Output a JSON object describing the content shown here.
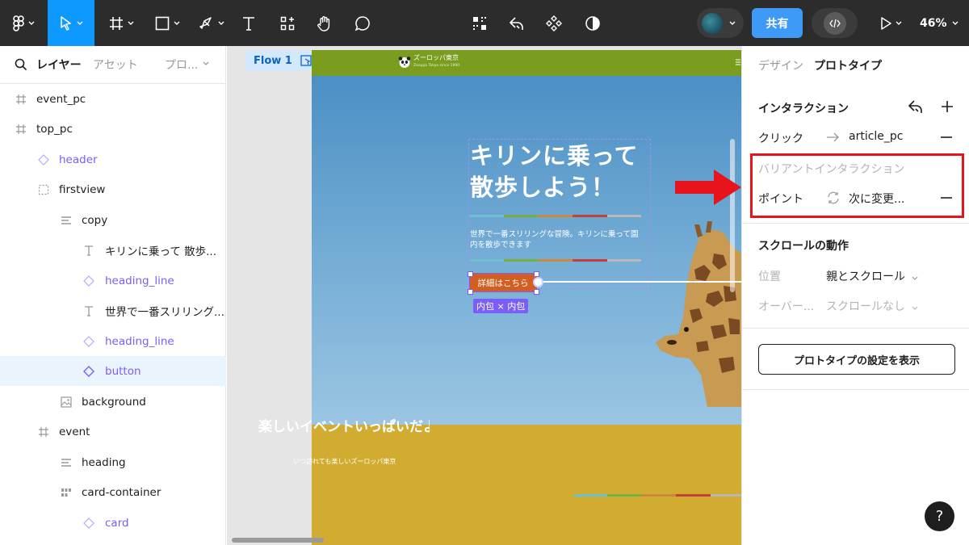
{
  "toolbar": {
    "zoom": "46%",
    "share_label": "共有"
  },
  "left_panel": {
    "tabs": {
      "layers": "レイヤー",
      "assets": "アセット",
      "pages": "プロ..."
    },
    "layers": [
      {
        "label": "event_pc"
      },
      {
        "label": "top_pc"
      },
      {
        "label": "header"
      },
      {
        "label": "firstview"
      },
      {
        "label": "copy"
      },
      {
        "label": "キリンに乗って 散歩..."
      },
      {
        "label": "heading_line"
      },
      {
        "label": "世界で一番スリリング..."
      },
      {
        "label": "heading_line"
      },
      {
        "label": "button"
      },
      {
        "label": "background"
      },
      {
        "label": "event"
      },
      {
        "label": "heading"
      },
      {
        "label": "card-container"
      },
      {
        "label": "card"
      }
    ]
  },
  "canvas": {
    "flow_label": "Flow 1",
    "site": {
      "logo": "ズーロッパ東京",
      "logo_sub": "Zooppa Tokyo since 1990",
      "hero_title": "キリンに乗って\n散歩しよう！",
      "hero_body": "世界で一番スリリングな冒険。キリンに乗って園内を散歩できます",
      "button_label": "詳細はこちら",
      "size_tag": "内包 × 内包",
      "event_title": "楽しいイベントいっぱいだよ",
      "event_sub": "いつ訪れても楽しいズーロッパ東京",
      "line_colors": [
        "#6ec2cf",
        "#76b041",
        "#c98a3b",
        "#c2413b",
        "#b8b8b8"
      ]
    }
  },
  "right_panel": {
    "tabs": {
      "design": "デザイン",
      "prototype": "プロトタイプ"
    },
    "interactions": {
      "title": "インタラクション",
      "trigger": "クリック",
      "target": "article_pc"
    },
    "variant": {
      "title": "バリアントインタラクション",
      "trigger": "ポイント",
      "action": "次に変更..."
    },
    "scroll": {
      "title": "スクロールの動作",
      "position_label": "位置",
      "position_value": "親とスクロール",
      "overflow_label": "オーバー...",
      "overflow_value": "スクロールなし"
    },
    "settings_button": "プロトタイプの設定を表示"
  },
  "help": "?",
  "colors": {
    "accent": "#0d99ff",
    "purple": "#7b5ef8",
    "annotation_red": "#e8141c"
  }
}
